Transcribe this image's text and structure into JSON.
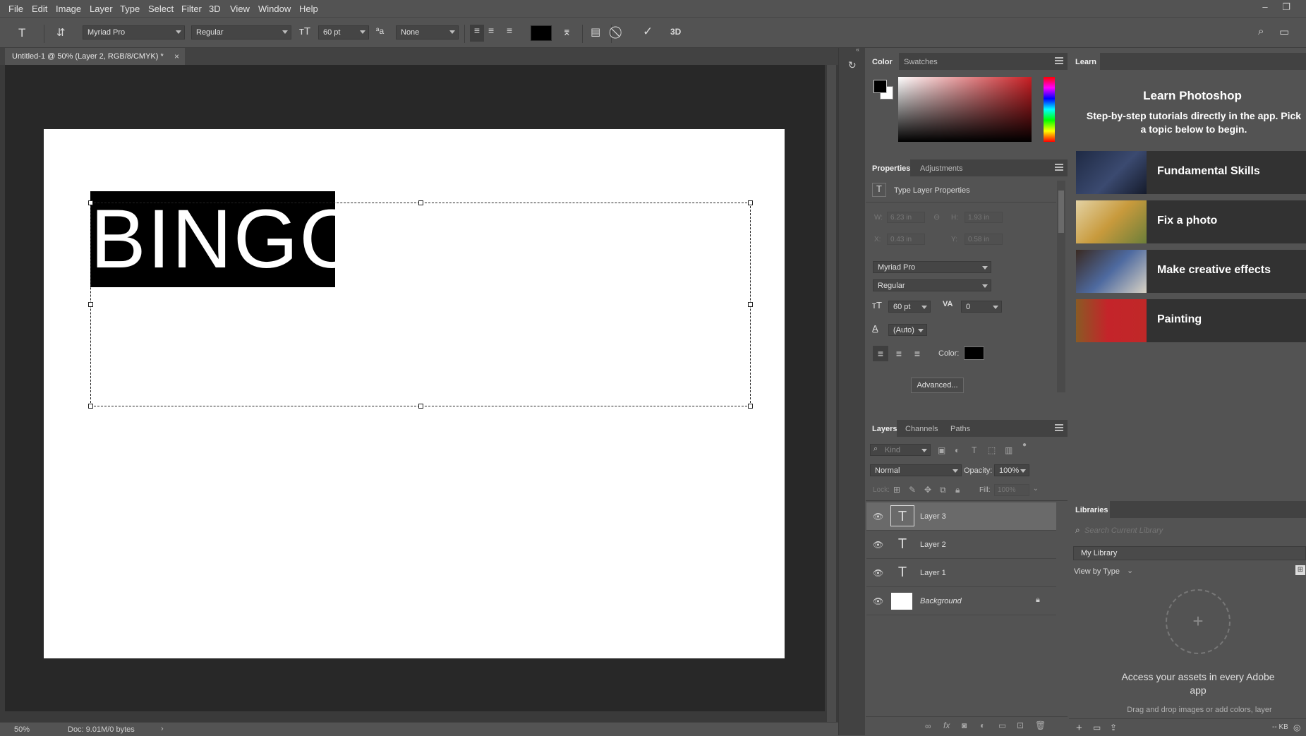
{
  "menubar": {
    "items": [
      "File",
      "Edit",
      "Image",
      "Layer",
      "Type",
      "Select",
      "Filter",
      "3D",
      "View",
      "Window",
      "Help"
    ]
  },
  "options": {
    "font_family": "Myriad Pro",
    "font_style": "Regular",
    "font_size": "60 pt",
    "antialias": "None",
    "text_color": "#000000",
    "label_3d": "3D"
  },
  "document": {
    "tab_title": "Untitled-1 @ 50% (Layer 2, RGB/8/CMYK) *",
    "close_glyph": "×",
    "text_content": "BINGO",
    "zoom": "50%",
    "doc_info": "Doc: 9.01M/0 bytes"
  },
  "color_panel": {
    "tabs": [
      "Color",
      "Swatches"
    ],
    "hue_color": "#c81e23"
  },
  "properties_panel": {
    "tabs": [
      "Properties",
      "Adjustments"
    ],
    "section_title": "Type Layer Properties",
    "w_label": "W:",
    "w_value": "6.23 in",
    "h_label": "H:",
    "h_value": "1.93 in",
    "x_label": "X:",
    "x_value": "0.43 in",
    "y_label": "Y:",
    "y_value": "0.58 in",
    "font_family": "Myriad Pro",
    "font_style": "Regular",
    "font_size": "60 pt",
    "tracking": "0",
    "leading": "(Auto)",
    "color_label": "Color:",
    "color_value": "#000000",
    "advanced_button": "Advanced..."
  },
  "layers_panel": {
    "tabs": [
      "Layers",
      "Channels",
      "Paths"
    ],
    "filter_placeholder": "Kind",
    "blend_mode": "Normal",
    "opacity_label": "Opacity:",
    "opacity_value": "100%",
    "lock_label": "Lock:",
    "fill_label": "Fill:",
    "fill_value": "100%",
    "layers": [
      {
        "name": "Layer 3",
        "type": "text",
        "selected": true
      },
      {
        "name": "Layer 2",
        "type": "text",
        "selected": false
      },
      {
        "name": "Layer 1",
        "type": "text",
        "selected": false
      },
      {
        "name": "Background",
        "type": "pixel",
        "selected": false,
        "locked": true
      }
    ]
  },
  "learn_panel": {
    "tab": "Learn",
    "title": "Learn Photoshop",
    "subtitle": "Step-by-step tutorials directly in the app. Pick a topic below to begin.",
    "cards": [
      {
        "label": "Fundamental Skills",
        "thumb_color": "#2b3550"
      },
      {
        "label": "Fix a photo",
        "thumb_color": "#c9b07a"
      },
      {
        "label": "Make creative effects",
        "thumb_color": "#3a4a6a"
      },
      {
        "label": "Painting",
        "thumb_color": "#b8282a"
      }
    ]
  },
  "libraries_panel": {
    "tab": "Libraries",
    "search_placeholder": "Search Current Library",
    "library_name": "My Library",
    "view_by": "View by Type",
    "empty_title": "Access your assets in every Adobe app",
    "empty_subtitle": "Drag and drop images or add colors, layer",
    "storage": "-- KB"
  }
}
